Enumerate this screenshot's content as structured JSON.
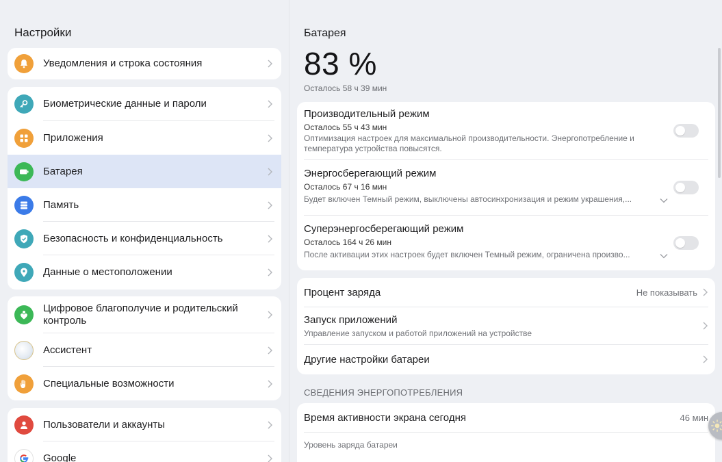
{
  "left": {
    "title": "Настройки",
    "items": [
      {
        "label": "Уведомления и строка состояния",
        "icon": "bell-icon",
        "color": "#f0a03a"
      },
      {
        "label": "Биометрические данные и пароли",
        "icon": "key-icon",
        "color": "#3fa8b8"
      },
      {
        "label": "Приложения",
        "icon": "apps-grid-icon",
        "color": "#f0a03a"
      },
      {
        "label": "Батарея",
        "icon": "battery-icon",
        "color": "#3cb857"
      },
      {
        "label": "Память",
        "icon": "storage-icon",
        "color": "#3b7be8"
      },
      {
        "label": "Безопасность и конфиденциальность",
        "icon": "shield-icon",
        "color": "#3fa8b8"
      },
      {
        "label": "Данные о местоположении",
        "icon": "location-pin-icon",
        "color": "#3fa8b8"
      },
      {
        "label": "Цифровое благополучие и родительский контроль",
        "icon": "heart-person-icon",
        "color": "#3cb857"
      },
      {
        "label": "Ассистент",
        "icon": "assistant-orb-icon",
        "color": "#dfe6ee"
      },
      {
        "label": "Специальные возможности",
        "icon": "hand-icon",
        "color": "#f0a03a"
      },
      {
        "label": "Пользователи и аккаунты",
        "icon": "user-icon",
        "color": "#e04a3f"
      },
      {
        "label": "Google",
        "icon": "google-icon",
        "color": "#ffffff"
      }
    ]
  },
  "right": {
    "title": "Батарея",
    "percent": "83 %",
    "remaining": "Осталось 58 ч 39 мин",
    "modes": [
      {
        "title": "Производительный режим",
        "remaining": "Осталось 55 ч 43 мин",
        "desc": "Оптимизация настроек для максимальной производительности. Энергопотребление и температура устройства повысятся."
      },
      {
        "title": "Энергосберегающий режим",
        "remaining": "Осталось 67 ч 16 мин",
        "desc": "Будет включен Темный режим, выключены автосинхронизация и режим украшения,..."
      },
      {
        "title": "Суперэнергосберегающий режим",
        "remaining": "Осталось 164 ч 26 мин",
        "desc": "После активации этих настроек будет включен Темный режим, ограничена произво..."
      }
    ],
    "options": [
      {
        "title": "Процент заряда",
        "value": "Не показывать"
      },
      {
        "title": "Запуск приложений",
        "subtitle": "Управление запуском и работой приложений на устройстве"
      },
      {
        "title": "Другие настройки батареи"
      }
    ],
    "section_header": "СВЕДЕНИЯ ЭНЕРГОПОТРЕБЛЕНИЯ",
    "screen_time": {
      "title": "Время активности экрана сегодня",
      "value": "46 мин"
    },
    "battery_level": "Уровень заряда батареи"
  }
}
